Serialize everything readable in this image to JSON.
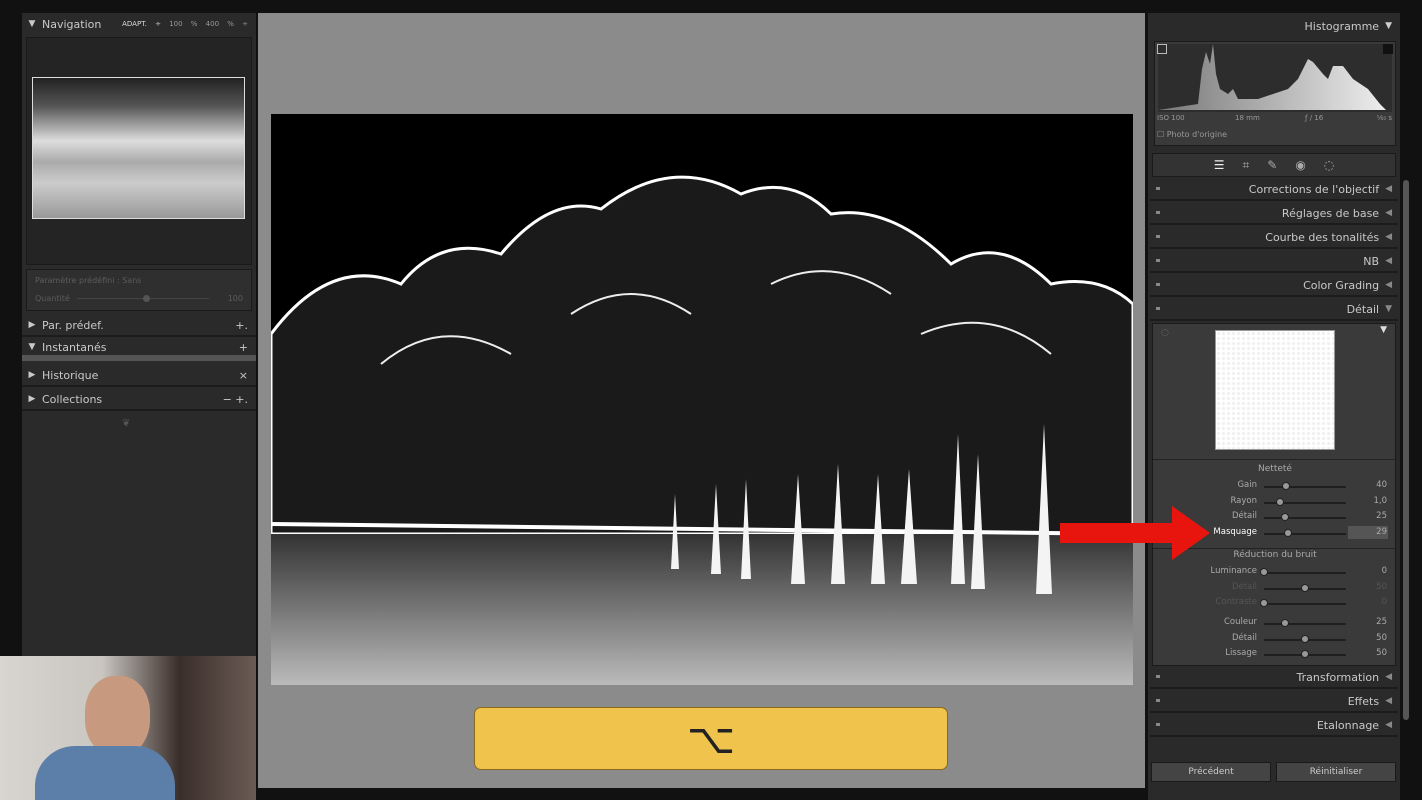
{
  "left_panel": {
    "navigation": {
      "title": "Navigation",
      "zoom_options": [
        "ADAPT. ÷",
        "100 %",
        "400 % ÷"
      ]
    },
    "preset": {
      "label": "Paramètre prédéfini : Sans",
      "amount_label": "Quantité",
      "amount_value": "100",
      "amount_level": 0.5
    },
    "sections": [
      {
        "label": "Par. prédef.",
        "expanded": false,
        "actions": "+."
      },
      {
        "label": "Instantanés",
        "expanded": true,
        "actions": "+"
      },
      {
        "label": "Historique",
        "expanded": false,
        "actions": "×"
      },
      {
        "label": "Collections",
        "expanded": false,
        "actions": "−  +."
      }
    ]
  },
  "center": {
    "key_overlay": "⌥"
  },
  "right_panel": {
    "histogram": {
      "title": "Histogramme",
      "iso": "ISO 100",
      "focal": "18 mm",
      "aperture": "ƒ / 16",
      "shutter": "¹⁄₆₀ s",
      "original_photo": "Photo d'origine"
    },
    "tools": [
      "sliders-icon",
      "crop-icon",
      "heal-icon",
      "redeye-icon",
      "mask-icon"
    ],
    "panels": [
      "Corrections de l'objectif",
      "Réglages de base",
      "Courbe des tonalités",
      "NB",
      "Color Grading",
      "Détail"
    ],
    "detail": {
      "sharpening_title": "Netteté",
      "sharpening": [
        {
          "label": "Gain",
          "value": "40",
          "level": 0.27
        },
        {
          "label": "Rayon",
          "value": "1,0",
          "level": 0.2
        },
        {
          "label": "Détail",
          "value": "25",
          "level": 0.25
        },
        {
          "label": "Masquage",
          "value": "29",
          "level": 0.29,
          "active": true
        }
      ],
      "noise_title": "Réduction du bruit",
      "noise": [
        {
          "label": "Luminance",
          "value": "0",
          "level": 0
        },
        {
          "label": "Détail",
          "value": "50",
          "level": 0.5,
          "dim": true
        },
        {
          "label": "Contraste",
          "value": "0",
          "level": 0,
          "dim": true
        },
        {
          "label": "Couleur",
          "value": "25",
          "level": 0.25
        },
        {
          "label": "Détail",
          "value": "50",
          "level": 0.5
        },
        {
          "label": "Lissage",
          "value": "50",
          "level": 0.5
        }
      ]
    },
    "bottom_panels": [
      "Transformation",
      "Effets",
      "Etalonnage"
    ],
    "buttons": {
      "previous": "Précédent",
      "reset": "Réinitialiser"
    }
  },
  "colors": {
    "arrow": "#e8150f",
    "key_overlay": "#efc34c"
  }
}
